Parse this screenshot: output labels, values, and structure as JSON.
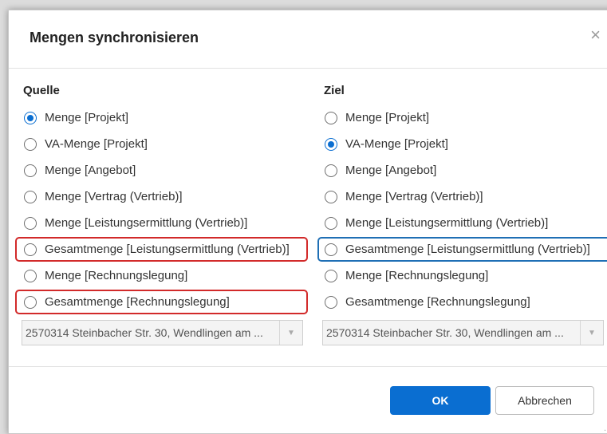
{
  "dialog": {
    "title": "Mengen synchronisieren",
    "close_glyph": "×"
  },
  "source": {
    "heading": "Quelle",
    "options": [
      {
        "label": "Menge [Projekt]",
        "checked": true
      },
      {
        "label": "VA-Menge [Projekt]",
        "checked": false
      },
      {
        "label": "Menge [Angebot]",
        "checked": false
      },
      {
        "label": "Menge [Vertrag (Vertrieb)]",
        "checked": false
      },
      {
        "label": "Menge [Leistungsermittlung (Vertrieb)]",
        "checked": false
      },
      {
        "label": "Gesamtmenge [Leistungsermittlung (Vertrieb)]",
        "checked": false
      },
      {
        "label": "Menge [Rechnungslegung]",
        "checked": false
      },
      {
        "label": "Gesamtmenge [Rechnungslegung]",
        "checked": false
      }
    ],
    "select_value": "2570314 Steinbacher Str. 30, Wendlingen am ..."
  },
  "target": {
    "heading": "Ziel",
    "options": [
      {
        "label": "Menge [Projekt]",
        "checked": false
      },
      {
        "label": "VA-Menge [Projekt]",
        "checked": true
      },
      {
        "label": "Menge [Angebot]",
        "checked": false
      },
      {
        "label": "Menge [Vertrag (Vertrieb)]",
        "checked": false
      },
      {
        "label": "Menge [Leistungsermittlung (Vertrieb)]",
        "checked": false
      },
      {
        "label": "Gesamtmenge [Leistungsermittlung (Vertrieb)]",
        "checked": false
      },
      {
        "label": "Menge [Rechnungslegung]",
        "checked": false
      },
      {
        "label": "Gesamtmenge [Rechnungslegung]",
        "checked": false
      }
    ],
    "select_value": "2570314 Steinbacher Str. 30, Wendlingen am ..."
  },
  "buttons": {
    "ok_label": "OK",
    "cancel_label": "Abbrechen"
  },
  "colors": {
    "accent": "#0a6ed1",
    "highlight_red": "#d22a2a",
    "highlight_blue": "#1f6fb5"
  }
}
